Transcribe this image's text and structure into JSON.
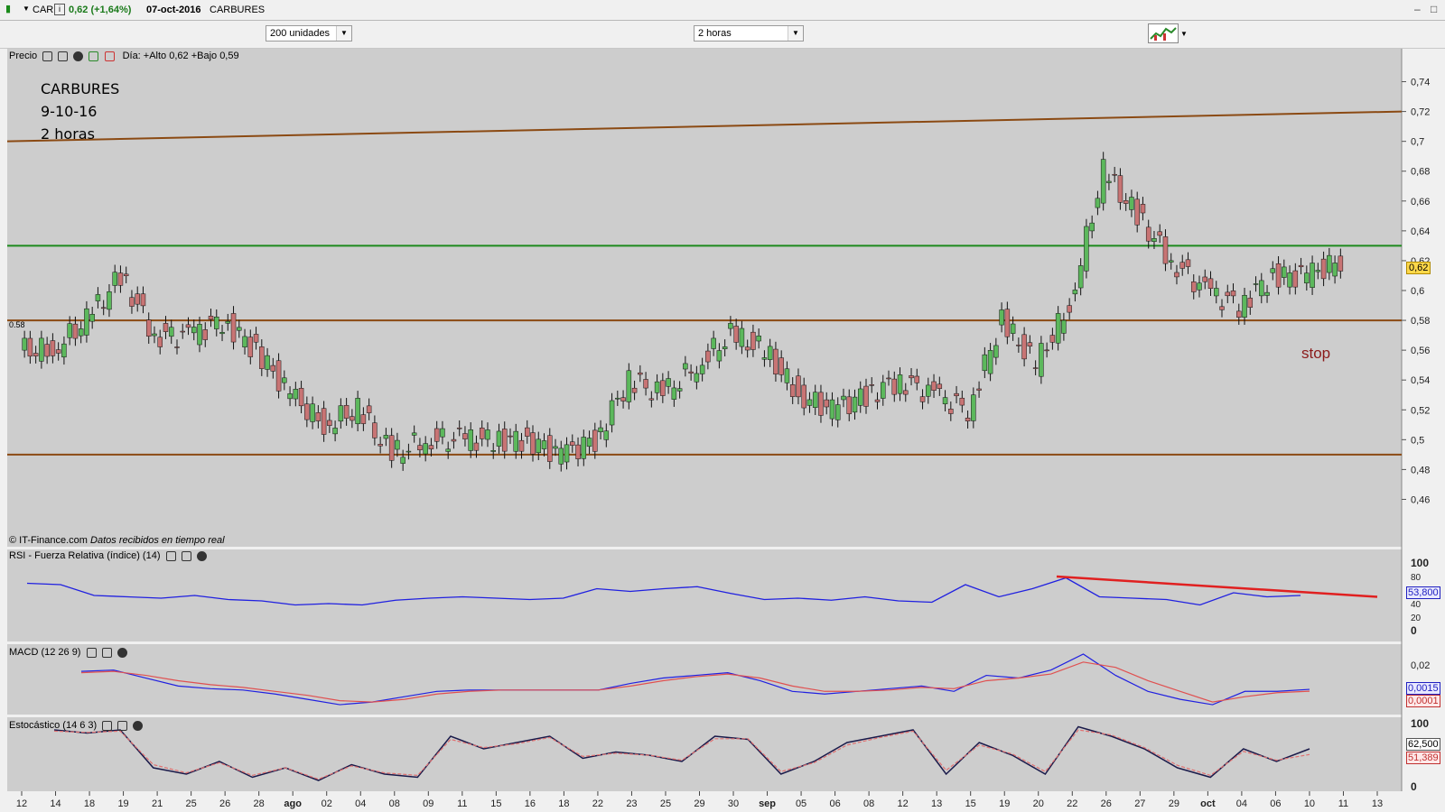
{
  "titlebar": {
    "symbol": "CAR",
    "quote": "0,62 (+1,64%)",
    "date": "07-oct-2016",
    "name": "CARBURES"
  },
  "toolbar": {
    "units_select": "200 unidades",
    "period_select": "2 horas"
  },
  "price_panel": {
    "title": "Precio",
    "day_info": "Día: +Alto 0,62 +Bajo 0,59",
    "annotation_lines": [
      "CARBURES",
      "9-10-16",
      "2 horas"
    ],
    "stop_text": "stop",
    "level_label": "0.58",
    "last_price_label": "0,62",
    "copyright": "© IT-Finance.com",
    "copyright_note": "Datos recibidos en tiempo real",
    "y_ticks": [
      "0,74",
      "0,72",
      "0,7",
      "0,68",
      "0,66",
      "0,64",
      "0,62",
      "0,6",
      "0,58",
      "0,56",
      "0,54",
      "0,52",
      "0,5",
      "0,48",
      "0,46"
    ]
  },
  "rsi_panel": {
    "title": "RSI - Fuerza Relativa (índice) (14)",
    "y_ticks": [
      "100",
      "80",
      "60",
      "40",
      "20",
      "0"
    ],
    "last_value": "53,800"
  },
  "macd_panel": {
    "title": "MACD (12 26 9)",
    "y_ticks": [
      "0,02",
      "0"
    ],
    "value_1": "0,0015",
    "value_2": "0,0001"
  },
  "stoch_panel": {
    "title": "Estocástico (14 6 3)",
    "y_ticks": [
      "100",
      "0"
    ],
    "value_1": "62,500",
    "value_2": "51,389"
  },
  "x_axis_labels": [
    "12",
    "14",
    "18",
    "19",
    "21",
    "25",
    "26",
    "28",
    "ago",
    "02",
    "04",
    "08",
    "09",
    "11",
    "15",
    "16",
    "18",
    "22",
    "23",
    "25",
    "29",
    "30",
    "sep",
    "05",
    "06",
    "08",
    "12",
    "13",
    "15",
    "19",
    "20",
    "22",
    "26",
    "27",
    "29",
    "oct",
    "04",
    "06",
    "10",
    "11",
    "13"
  ],
  "colors": {
    "chart_bg": "#cdcdcd",
    "up_candle": "#5cb85c",
    "down_candle": "#c87474",
    "trend_brown": "#8b4a13",
    "resistance_green": "#1c8a1c",
    "rsi_line": "#2020e0",
    "rsi_trend": "#e02020",
    "stop_text": "#8b1a1a"
  },
  "chart_data": [
    {
      "type": "candlestick",
      "title": "CARBURES",
      "ylim": [
        0.45,
        0.75
      ],
      "x": [
        "12",
        "14",
        "18",
        "19",
        "21",
        "25",
        "26",
        "28",
        "ago",
        "02",
        "04",
        "08",
        "09",
        "11",
        "15",
        "16",
        "18",
        "22",
        "23",
        "25",
        "29",
        "30",
        "sep",
        "05",
        "06",
        "08",
        "12",
        "13",
        "15",
        "19",
        "20",
        "22",
        "26",
        "27",
        "29",
        "oct",
        "04",
        "06",
        "10",
        "11",
        "13"
      ],
      "close": [
        0.56,
        0.58,
        0.61,
        0.57,
        0.57,
        0.58,
        0.56,
        0.53,
        0.51,
        0.52,
        0.49,
        0.5,
        0.5,
        0.5,
        0.5,
        0.49,
        0.5,
        0.54,
        0.53,
        0.55,
        0.57,
        0.56,
        0.53,
        0.52,
        0.53,
        0.54,
        0.53,
        0.52,
        0.58,
        0.55,
        0.59,
        0.68,
        0.65,
        0.62,
        0.6,
        0.59,
        0.61,
        0.61,
        0.62,
        null,
        null
      ],
      "lines": [
        {
          "name": "trend_top",
          "from": [
            0,
            0.7
          ],
          "to": [
            40,
            0.72
          ]
        },
        {
          "name": "resistance",
          "y": 0.63
        },
        {
          "name": "support_058",
          "y": 0.58
        },
        {
          "name": "support_049",
          "y": 0.49
        }
      ],
      "last": 0.62,
      "day_high": 0.62,
      "day_low": 0.59
    },
    {
      "type": "line",
      "title": "RSI - Fuerza Relativa (índice) (14)",
      "ylim": [
        0,
        100
      ],
      "values": [
        70,
        68,
        52,
        50,
        48,
        52,
        46,
        44,
        38,
        40,
        38,
        45,
        48,
        50,
        48,
        46,
        48,
        62,
        58,
        62,
        65,
        55,
        46,
        48,
        45,
        50,
        44,
        42,
        68,
        50,
        62,
        78,
        50,
        48,
        46,
        38,
        56,
        50,
        52
      ],
      "last": 53.8
    },
    {
      "type": "line",
      "title": "MACD (12 26 9)",
      "series": [
        {
          "values": [
            0.015,
            0.016,
            0.01,
            0.004,
            0.002,
            0.001,
            -0.002,
            -0.006,
            -0.01,
            -0.008,
            -0.004,
            0.0,
            0.001,
            0.001,
            0.001,
            0.001,
            0.001,
            0.006,
            0.01,
            0.012,
            0.014,
            0.008,
            0.0,
            -0.002,
            0.0,
            0.002,
            0.004,
            0.0,
            0.012,
            0.01,
            0.016,
            0.028,
            0.012,
            0.0,
            -0.006,
            -0.01,
            0.0,
            0.0,
            0.0015
          ]
        },
        {
          "values": [
            0.014,
            0.015,
            0.012,
            0.008,
            0.005,
            0.003,
            0.0,
            -0.003,
            -0.007,
            -0.008,
            -0.006,
            -0.002,
            0.0,
            0.001,
            0.001,
            0.001,
            0.001,
            0.004,
            0.008,
            0.011,
            0.013,
            0.01,
            0.004,
            0.0,
            0.0,
            0.001,
            0.003,
            0.002,
            0.008,
            0.01,
            0.013,
            0.022,
            0.018,
            0.008,
            0.0,
            -0.008,
            -0.004,
            -0.001,
            0.0001
          ]
        }
      ],
      "last": [
        0.0015,
        0.0001
      ]
    },
    {
      "type": "line",
      "title": "Estocástico (14 6 3)",
      "ylim": [
        0,
        100
      ],
      "series": [
        {
          "values": [
            90,
            85,
            90,
            30,
            20,
            40,
            15,
            30,
            10,
            35,
            20,
            15,
            80,
            60,
            70,
            80,
            45,
            55,
            50,
            40,
            80,
            75,
            20,
            40,
            70,
            80,
            90,
            20,
            70,
            50,
            20,
            95,
            80,
            60,
            30,
            15,
            60,
            40,
            60
          ]
        },
        {
          "values": [
            88,
            86,
            88,
            35,
            22,
            38,
            18,
            30,
            12,
            33,
            22,
            18,
            75,
            62,
            68,
            78,
            48,
            53,
            50,
            42,
            76,
            76,
            24,
            38,
            66,
            78,
            88,
            26,
            66,
            52,
            24,
            90,
            82,
            62,
            34,
            18,
            56,
            42,
            51
          ]
        }
      ],
      "last": [
        62.5,
        51.389
      ]
    }
  ]
}
